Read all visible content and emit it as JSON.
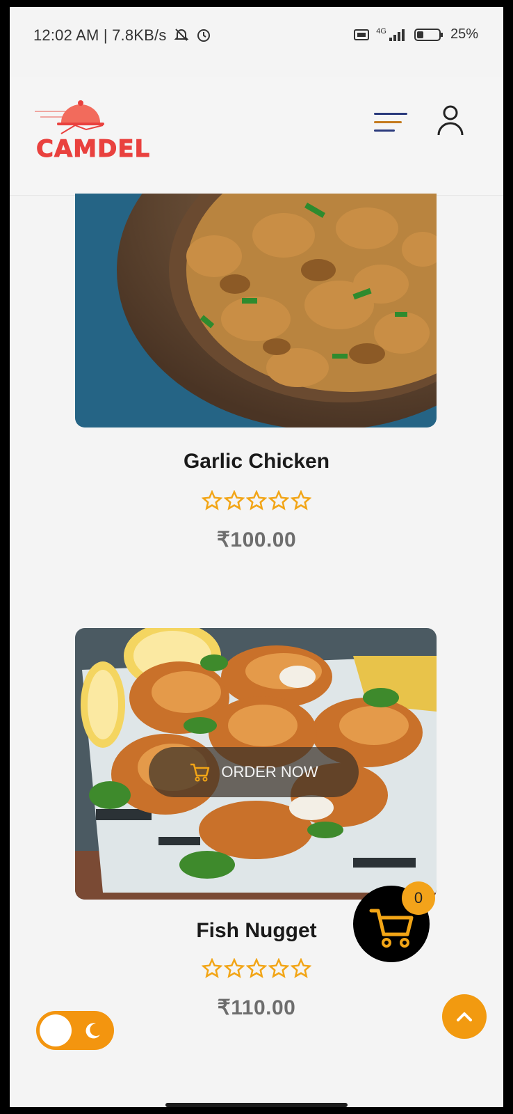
{
  "status_bar": {
    "time": "12:02 AM | 7.8KB/s",
    "network": "4G",
    "battery": "25%"
  },
  "header": {
    "logo_text": "CAMDEL",
    "menu_icon": "hamburger-menu-icon",
    "user_icon": "user-icon"
  },
  "products": [
    {
      "name": "Garlic Chicken",
      "rating_stars": 5,
      "price": "₹100.00"
    },
    {
      "name": "Fish Nugget",
      "rating_stars": 5,
      "price": "₹110.00"
    }
  ],
  "order_button": {
    "label": "ORDER NOW"
  },
  "cart": {
    "count": "0"
  },
  "colors": {
    "accent": "#f29a10",
    "brand": "#e9413e",
    "price_gray": "#6d6d6d"
  }
}
